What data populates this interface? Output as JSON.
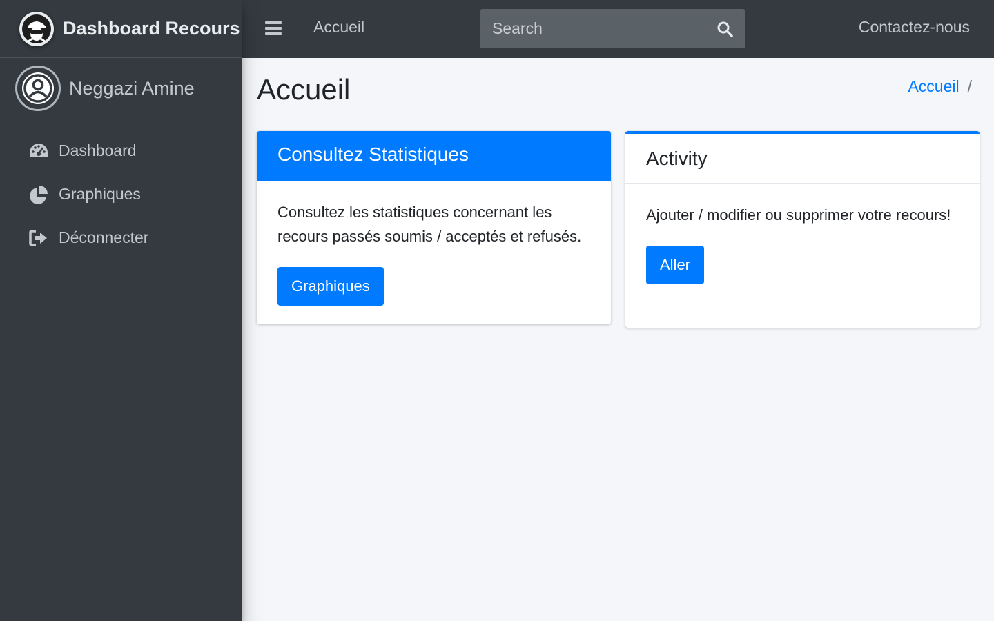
{
  "brand": {
    "title": "Dashboard Recours"
  },
  "user": {
    "name": "Neggazi Amine"
  },
  "sidebar": {
    "items": [
      {
        "label": "Dashboard",
        "icon": "dashboard-icon"
      },
      {
        "label": "Graphiques",
        "icon": "pie-chart-icon"
      },
      {
        "label": "Déconnecter",
        "icon": "sign-out-icon"
      }
    ]
  },
  "topbar": {
    "home_link": "Accueil",
    "search_placeholder": "Search",
    "contact_link": "Contactez-nous"
  },
  "page": {
    "title": "Accueil",
    "breadcrumb": [
      "Accueil",
      "/"
    ]
  },
  "cards": [
    {
      "title": "Consultez Statistiques",
      "text": "Consultez les statistiques concernant les recours passés soumis / acceptés et refusés.",
      "button": "Graphiques"
    },
    {
      "title": "Activity",
      "text": "Ajouter / modifier ou supprimer votre recours!",
      "button": "Aller"
    }
  ],
  "colors": {
    "sidebar_bg": "#343a40",
    "primary": "#007bff",
    "content_bg": "#f4f6f9"
  }
}
